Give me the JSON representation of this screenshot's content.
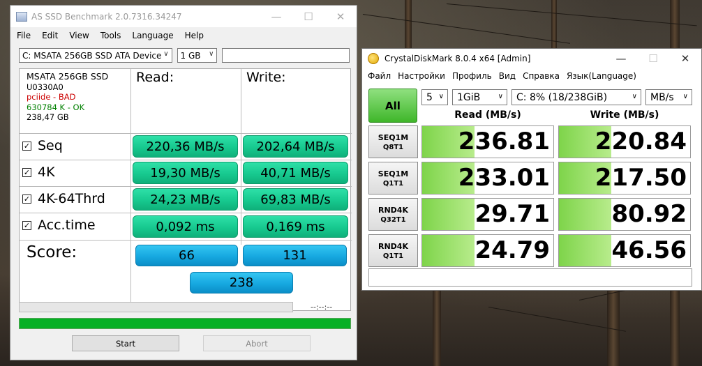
{
  "asssd": {
    "title": "AS SSD Benchmark 2.0.7316.34247",
    "menu": [
      "File",
      "Edit",
      "View",
      "Tools",
      "Language",
      "Help"
    ],
    "drive_select": "C: MSATA 256GB SSD ATA Device",
    "size_select": "1 GB",
    "drive_info": {
      "model": "MSATA 256GB SSD",
      "firmware": "U0330A0",
      "driver": "pciide - BAD",
      "alignment": "630784 K - OK",
      "capacity": "238,47 GB"
    },
    "headers": {
      "read": "Read:",
      "write": "Write:"
    },
    "rows": [
      {
        "label": "Seq",
        "read": "220,36 MB/s",
        "write": "202,64 MB/s"
      },
      {
        "label": "4K",
        "read": "19,30 MB/s",
        "write": "40,71 MB/s"
      },
      {
        "label": "4K-64Thrd",
        "read": "24,23 MB/s",
        "write": "69,83 MB/s"
      },
      {
        "label": "Acc.time",
        "read": "0,092 ms",
        "write": "0,169 ms"
      }
    ],
    "score_label": "Score:",
    "score_read": "66",
    "score_write": "131",
    "score_total": "238",
    "timer": "--:--:--",
    "progress_top": 0,
    "progress_bottom": 1,
    "start_label": "Start",
    "abort_label": "Abort",
    "colors": {
      "green_result": "#17c98f",
      "blue_score": "#16a8e0",
      "progress": "#06b025",
      "bad": "#cc0000",
      "ok": "#008000"
    }
  },
  "cdm": {
    "title": "CrystalDiskMark 8.0.4 x64 [Admin]",
    "menu": [
      "Файл",
      "Настройки",
      "Профиль",
      "Вид",
      "Справка",
      "Язык(Language)"
    ],
    "all_label": "All",
    "count_select": "5",
    "size_select": "1GiB",
    "drive_select": "C: 8% (18/238GiB)",
    "unit_select": "MB/s",
    "read_header": "Read (MB/s)",
    "write_header": "Write (MB/s)",
    "tests": [
      {
        "line1": "SEQ1M",
        "line2": "Q8T1",
        "read": "236.81",
        "write": "220.84",
        "read_fill": 0.4,
        "write_fill": 0.4
      },
      {
        "line1": "SEQ1M",
        "line2": "Q1T1",
        "read": "233.01",
        "write": "217.50",
        "read_fill": 0.4,
        "write_fill": 0.4
      },
      {
        "line1": "RND4K",
        "line2": "Q32T1",
        "read": "29.71",
        "write": "80.92",
        "read_fill": 0.4,
        "write_fill": 0.4
      },
      {
        "line1": "RND4K",
        "line2": "Q1T1",
        "read": "24.79",
        "write": "46.56",
        "read_fill": 0.4,
        "write_fill": 0.4
      }
    ],
    "status_text": "",
    "colors": {
      "all_button": "#3fb62a",
      "bar": "#7ed44a"
    }
  }
}
